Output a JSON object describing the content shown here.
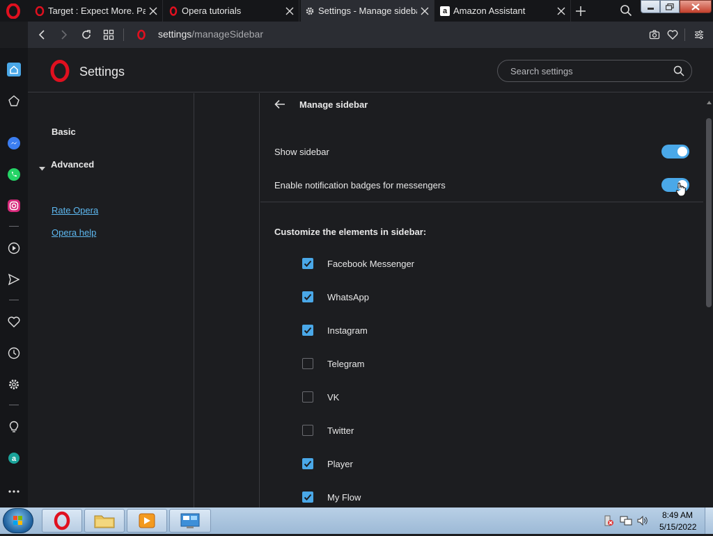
{
  "tabs": [
    {
      "title": "Target : Expect More. Pay L",
      "active": false
    },
    {
      "title": "Opera tutorials",
      "active": false
    },
    {
      "title": "Settings - Manage sidebar",
      "active": true
    },
    {
      "title": "Amazon Assistant",
      "active": false
    }
  ],
  "address": {
    "prefix": "settings",
    "path": "/manageSidebar"
  },
  "header": {
    "title": "Settings",
    "search_placeholder": "Search settings"
  },
  "nav": {
    "basic": "Basic",
    "advanced": "Advanced",
    "rate": "Rate Opera",
    "help": "Opera help"
  },
  "page": {
    "title": "Manage sidebar",
    "show_sidebar": "Show sidebar",
    "badges": "Enable notification badges for messengers",
    "customize": "Customize the elements in sidebar:",
    "items": [
      {
        "label": "Facebook Messenger",
        "checked": true
      },
      {
        "label": "WhatsApp",
        "checked": true
      },
      {
        "label": "Instagram",
        "checked": true
      },
      {
        "label": "Telegram",
        "checked": false
      },
      {
        "label": "VK",
        "checked": false
      },
      {
        "label": "Twitter",
        "checked": false
      },
      {
        "label": "Player",
        "checked": true
      },
      {
        "label": "My Flow",
        "checked": true
      }
    ]
  },
  "clock": {
    "time": "8:49 AM",
    "date": "5/15/2022"
  },
  "colors": {
    "accent": "#4aa8e8",
    "opera_red": "#e0101f",
    "bg": "#1c1d20"
  }
}
